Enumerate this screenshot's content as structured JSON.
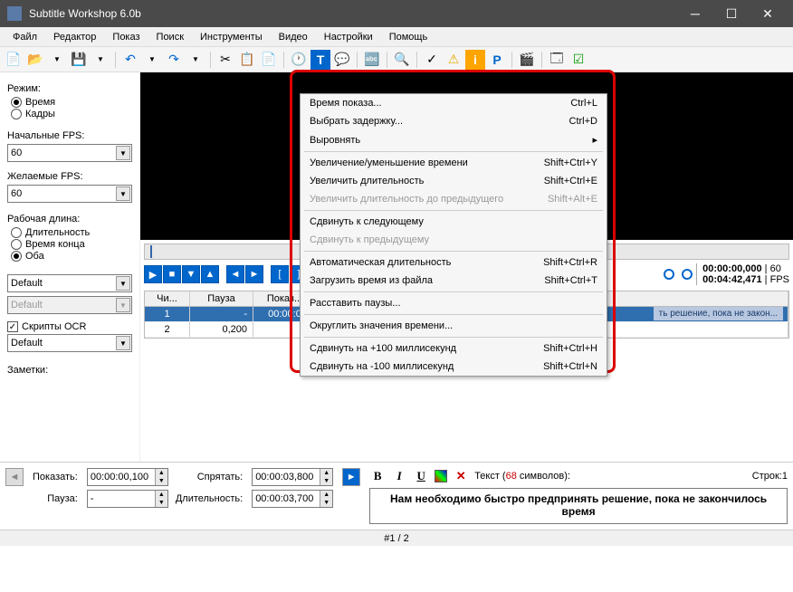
{
  "window": {
    "title": "Subtitle Workshop 6.0b"
  },
  "menu": {
    "file": "Файл",
    "editor": "Редактор",
    "show": "Показ",
    "search": "Поиск",
    "tools": "Инструменты",
    "video": "Видео",
    "settings": "Настройки",
    "help": "Помощь"
  },
  "sidebar": {
    "mode_label": "Режим:",
    "mode_time": "Время",
    "mode_frames": "Кадры",
    "fps_in_label": "Начальные FPS:",
    "fps_in": "60",
    "fps_out_label": "Желаемые FPS:",
    "fps_out": "60",
    "worklen_label": "Рабочая длина:",
    "wl_duration": "Длительность",
    "wl_end": "Время конца",
    "wl_both": "Оба",
    "combo1": "Default",
    "combo2": "Default",
    "ocr_label": "Скрипты OCR",
    "ocr_combo": "Default",
    "notes_label": "Заметки:"
  },
  "timebar": {
    "t1": "00:00:00,000",
    "t2": "00:04:42,471",
    "fps": "60",
    "fps_label": "FPS"
  },
  "table": {
    "h1": "Чи...",
    "h2": "Пауза",
    "h3": "Показ...",
    "r1": {
      "num": "1",
      "pause": "-",
      "show": "00:00:0"
    },
    "r2": {
      "num": "2",
      "pause": "0,200",
      "show": ""
    },
    "row2_overflow": "ть решение, пока не закон..."
  },
  "footer": {
    "show_label": "Показать:",
    "show_val": "00:00:00,100",
    "hide_label": "Спрятать:",
    "hide_val": "00:00:03,800",
    "pause_label": "Пауза:",
    "pause_val": "-",
    "dur_label": "Длительность:",
    "dur_val": "00:00:03,700",
    "text_label": "Текст (",
    "chars": "68",
    "chars_suffix": " символов):",
    "line_label": "Строк:",
    "line_val": "1",
    "text": "Нам необходимо быстро предпринять решение, пока не закончилось время"
  },
  "status": {
    "page": "#1 / 2"
  },
  "dropdown": [
    {
      "label": "Время показа...",
      "shortcut": "Ctrl+L"
    },
    {
      "label": "Выбрать задержку...",
      "shortcut": "Ctrl+D"
    },
    {
      "label": "Выровнять",
      "shortcut": "",
      "sub": true
    },
    {
      "sep": true
    },
    {
      "label": "Увеличение/уменьшение времени",
      "shortcut": "Shift+Ctrl+Y"
    },
    {
      "label": "Увеличить длительность",
      "shortcut": "Shift+Ctrl+E"
    },
    {
      "label": "Увеличить длительность до предыдущего",
      "shortcut": "Shift+Alt+E",
      "disabled": true
    },
    {
      "sep": true
    },
    {
      "label": "Сдвинуть к следующему",
      "shortcut": ""
    },
    {
      "label": "Сдвинуть к предыдущему",
      "shortcut": "",
      "disabled": true
    },
    {
      "sep": true
    },
    {
      "label": "Автоматическая длительность",
      "shortcut": "Shift+Ctrl+R"
    },
    {
      "label": "Загрузить время из файла",
      "shortcut": "Shift+Ctrl+T"
    },
    {
      "sep": true
    },
    {
      "label": "Расставить паузы...",
      "shortcut": ""
    },
    {
      "sep": true
    },
    {
      "label": "Округлить значения времени...",
      "shortcut": ""
    },
    {
      "sep": true
    },
    {
      "label": "Сдвинуть на +100 миллисекунд",
      "shortcut": "Shift+Ctrl+H"
    },
    {
      "label": "Сдвинуть на -100 миллисекунд",
      "shortcut": "Shift+Ctrl+N"
    }
  ]
}
